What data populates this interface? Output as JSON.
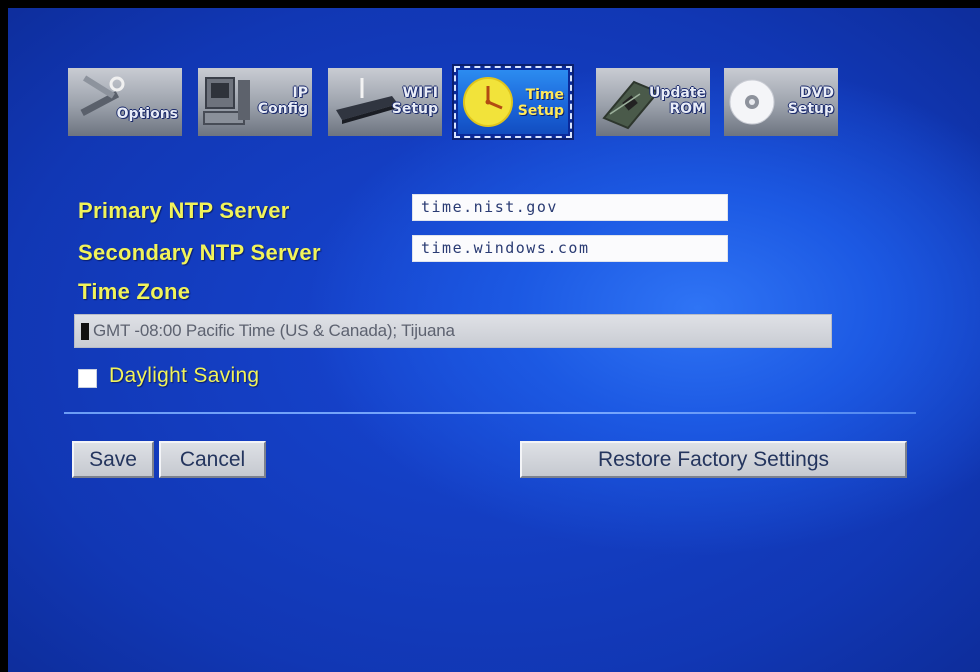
{
  "tabs": [
    {
      "id": "options",
      "label": "Options",
      "icon": "tools-icon"
    },
    {
      "id": "ip-config",
      "label": "IP\nConfig",
      "icon": "computer-icon"
    },
    {
      "id": "wifi-setup",
      "label": "WIFI\nSetup",
      "icon": "router-icon"
    },
    {
      "id": "time-setup",
      "label": "Time\nSetup",
      "icon": "clock-icon",
      "active": true
    },
    {
      "id": "update-rom",
      "label": "Update\nROM",
      "icon": "circuit-board-icon"
    },
    {
      "id": "dvd-setup",
      "label": "DVD\nSetup",
      "icon": "disc-icon"
    }
  ],
  "form": {
    "primary_label": "Primary NTP Server",
    "primary_value": "time.nist.gov",
    "secondary_label": "Secondary NTP Server",
    "secondary_value": "time.windows.com",
    "timezone_label": "Time Zone",
    "timezone_value": "GMT -08:00 Pacific Time (US & Canada); Tijuana",
    "daylight_label": "Daylight Saving",
    "daylight_checked": false
  },
  "buttons": {
    "save": "Save",
    "cancel": "Cancel",
    "restore": "Restore Factory Settings"
  },
  "colors": {
    "background": "#1745d0",
    "label_text": "#f1f35a",
    "active_tab": "#1a63d8"
  }
}
